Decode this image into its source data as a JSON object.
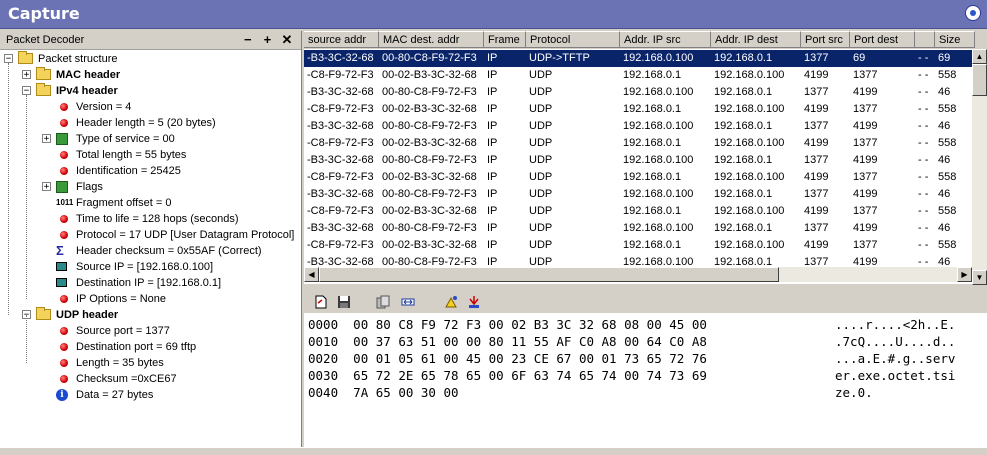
{
  "window": {
    "title": "Capture",
    "settings_icon": "gear-icon"
  },
  "decoder": {
    "title": "Packet Decoder",
    "buttons": [
      "−",
      "+",
      "✕"
    ],
    "tree": [
      {
        "label": "Packet structure",
        "icon": "folder-icon",
        "bold": false
      },
      {
        "label": "MAC header",
        "icon": "folder-icon",
        "bold": true
      },
      {
        "label": "IPv4 header",
        "icon": "folder-icon",
        "bold": true
      },
      {
        "label": "Version = 4",
        "icon": "red-dot-icon"
      },
      {
        "label": "Header length = 5 (20 bytes)",
        "icon": "red-dot-icon"
      },
      {
        "label": "Type of service = 00",
        "icon": "grid-icon"
      },
      {
        "label": "Total length = 55 bytes",
        "icon": "red-dot-icon"
      },
      {
        "label": "Identification = 25425",
        "icon": "red-dot-icon"
      },
      {
        "label": "Flags",
        "icon": "grid-icon"
      },
      {
        "label": "Fragment offset = 0",
        "icon": "binary-icon",
        "icon_text": "1011"
      },
      {
        "label": "Time to life = 128 hops (seconds)",
        "icon": "red-dot-icon"
      },
      {
        "label": "Protocol = 17 UDP [User Datagram Protocol]",
        "icon": "red-dot-icon"
      },
      {
        "label": "Header checksum = 0x55AF (Correct)",
        "icon": "sigma-icon",
        "icon_text": "Σ"
      },
      {
        "label": "Source  IP = [192.168.0.100]",
        "icon": "monitor-icon"
      },
      {
        "label": "Destination IP = [192.168.0.1]",
        "icon": "monitor-icon"
      },
      {
        "label": "IP Options = None",
        "icon": "red-dot-icon"
      },
      {
        "label": "UDP header",
        "icon": "folder-icon",
        "bold": true
      },
      {
        "label": "Source port = 1377",
        "icon": "red-dot-icon"
      },
      {
        "label": "Destination port = 69   tftp",
        "icon": "red-dot-icon"
      },
      {
        "label": "Length = 35 bytes",
        "icon": "red-dot-icon"
      },
      {
        "label": "Checksum =0xCE67",
        "icon": "red-dot-icon"
      },
      {
        "label": "Data = 27 bytes",
        "icon": "info-icon",
        "icon_text": "i"
      }
    ]
  },
  "packets": {
    "columns": [
      "source addr",
      "MAC dest. addr",
      "Frame",
      "Protocol",
      "Addr. IP src",
      "Addr. IP dest",
      "Port src",
      "Port dest",
      "",
      "Size"
    ],
    "rows": [
      [
        "-B3-3C-32-68",
        "00-80-C8-F9-72-F3",
        "IP",
        "UDP->TFTP",
        "192.168.0.100",
        "192.168.0.1",
        "1377",
        "69",
        "- -",
        "69"
      ],
      [
        "-C8-F9-72-F3",
        "00-02-B3-3C-32-68",
        "IP",
        "UDP",
        "192.168.0.1",
        "192.168.0.100",
        "4199",
        "1377",
        "- -",
        "558"
      ],
      [
        "-B3-3C-32-68",
        "00-80-C8-F9-72-F3",
        "IP",
        "UDP",
        "192.168.0.100",
        "192.168.0.1",
        "1377",
        "4199",
        "- -",
        "46"
      ],
      [
        "-C8-F9-72-F3",
        "00-02-B3-3C-32-68",
        "IP",
        "UDP",
        "192.168.0.1",
        "192.168.0.100",
        "4199",
        "1377",
        "- -",
        "558"
      ],
      [
        "-B3-3C-32-68",
        "00-80-C8-F9-72-F3",
        "IP",
        "UDP",
        "192.168.0.100",
        "192.168.0.1",
        "1377",
        "4199",
        "- -",
        "46"
      ],
      [
        "-C8-F9-72-F3",
        "00-02-B3-3C-32-68",
        "IP",
        "UDP",
        "192.168.0.1",
        "192.168.0.100",
        "4199",
        "1377",
        "- -",
        "558"
      ],
      [
        "-B3-3C-32-68",
        "00-80-C8-F9-72-F3",
        "IP",
        "UDP",
        "192.168.0.100",
        "192.168.0.1",
        "1377",
        "4199",
        "- -",
        "46"
      ],
      [
        "-C8-F9-72-F3",
        "00-02-B3-3C-32-68",
        "IP",
        "UDP",
        "192.168.0.1",
        "192.168.0.100",
        "4199",
        "1377",
        "- -",
        "558"
      ],
      [
        "-B3-3C-32-68",
        "00-80-C8-F9-72-F3",
        "IP",
        "UDP",
        "192.168.0.100",
        "192.168.0.1",
        "1377",
        "4199",
        "- -",
        "46"
      ],
      [
        "-C8-F9-72-F3",
        "00-02-B3-3C-32-68",
        "IP",
        "UDP",
        "192.168.0.1",
        "192.168.0.100",
        "4199",
        "1377",
        "- -",
        "558"
      ],
      [
        "-B3-3C-32-68",
        "00-80-C8-F9-72-F3",
        "IP",
        "UDP",
        "192.168.0.100",
        "192.168.0.1",
        "1377",
        "4199",
        "- -",
        "46"
      ],
      [
        "-C8-F9-72-F3",
        "00-02-B3-3C-32-68",
        "IP",
        "UDP",
        "192.168.0.1",
        "192.168.0.100",
        "4199",
        "1377",
        "- -",
        "558"
      ],
      [
        "-B3-3C-32-68",
        "00-80-C8-F9-72-F3",
        "IP",
        "UDP",
        "192.168.0.100",
        "192.168.0.1",
        "1377",
        "4199",
        "- -",
        "46"
      ]
    ],
    "selected_row": 0
  },
  "hex_toolbar": [
    "new-page-icon",
    "save-icon",
    "copy-icon",
    "fit-width-icon",
    "highlight-icon",
    "capture-icon"
  ],
  "hex": {
    "lines": [
      {
        "offset": "0000",
        "bytes": "00 80 C8 F9 72 F3 00 02 B3 3C 32 68 08 00 45 00",
        "ascii": "....r....<2h..E."
      },
      {
        "offset": "0010",
        "bytes": "00 37 63 51 00 00 80 11 55 AF C0 A8 00 64 C0 A8",
        "ascii": ".7cQ....U....d.."
      },
      {
        "offset": "0020",
        "bytes": "00 01 05 61 00 45 00 23 CE 67 00 01 73 65 72 76",
        "ascii": "...a.E.#.g..serv"
      },
      {
        "offset": "0030",
        "bytes": "65 72 2E 65 78 65 00 6F 63 74 65 74 00 74 73 69",
        "ascii": "er.exe.octet.tsi"
      },
      {
        "offset": "0040",
        "bytes": "7A 65 00 30 00",
        "ascii": "ze.0."
      }
    ]
  },
  "colors": {
    "title_bar": "#6b73b5",
    "selection": "#0a246a",
    "bullet": "#d00000"
  }
}
